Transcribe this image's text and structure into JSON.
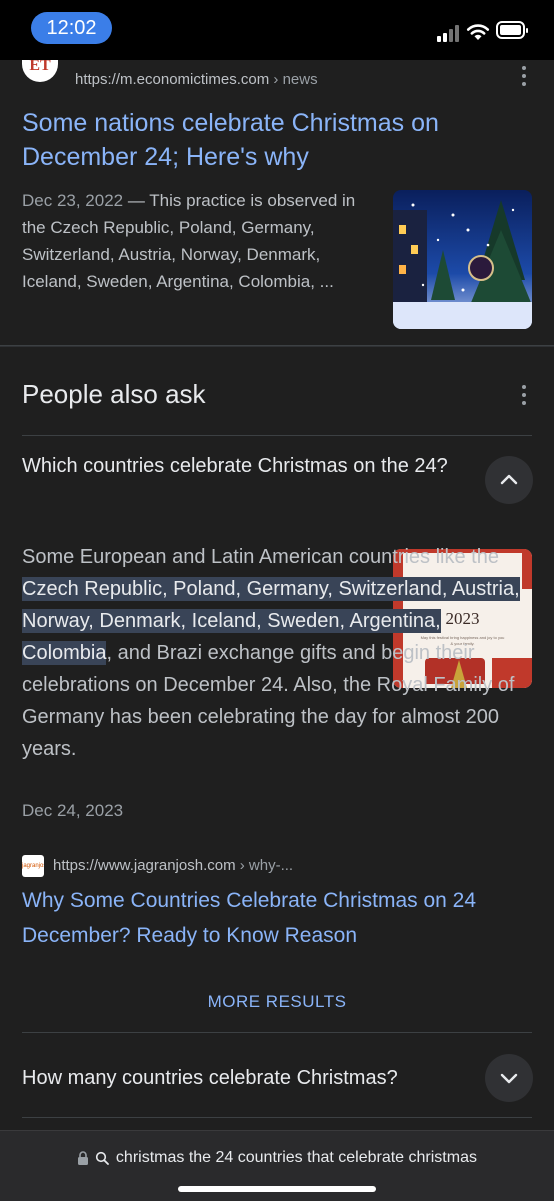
{
  "status": {
    "time": "12:02"
  },
  "result1": {
    "favicon_text": "ET",
    "url": "https://m.economictimes.com",
    "crumb": " › news",
    "title": "Some nations celebrate Christmas on December 24; Here's why",
    "date": "Dec 23, 2022",
    "separator": " — ",
    "snippet": "This practice is observed in the Czech Republic, Poland, Germany, Switzerland, Austria, Norway, Denmark, Iceland, Sweden, Argentina, Colombia, ..."
  },
  "paa": {
    "title": "People also ask",
    "question1": "Which countries celebrate Christmas on the 24?",
    "answer_pre": "Some European and Latin American countries like the ",
    "answer_highlight": "Czech Republic, Poland, Germany, Switzerland, Austria, Norway, Denmark, Iceland, Sweden, Argentina, Colombia",
    "answer_post": ", and Brazi exchange gifts and begin their celebrations on December 24. Also, the Royal Family of Germany has been celebrating the day for almost 200 years.",
    "answer_date": "Dec 24, 2023",
    "thumb_title": "CHRISTMAS",
    "thumb_year": "2023",
    "thumb_sub": "May this festival bring happiness and joy to you & your family.",
    "source_favicon_text": "jagranjosh",
    "source_url": "https://www.jagranjosh.com",
    "source_crumb": " › why-...",
    "source_title": "Why Some Countries Celebrate Christmas on 24 December? Ready to Know Reason",
    "more_results": "MORE RESULTS",
    "question2": "How many countries celebrate Christmas?"
  },
  "address_bar": {
    "text": "christmas the 24 countries that celebrate christmas"
  },
  "colors": {
    "link": "#8ab4f8",
    "highlight": "#394457",
    "time_pill": "#3b7ee8"
  }
}
